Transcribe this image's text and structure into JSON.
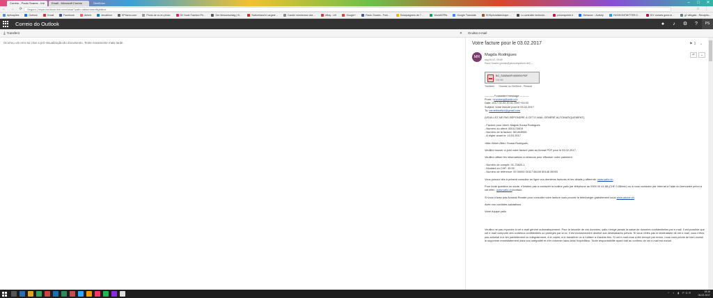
{
  "browser": {
    "tabs": [
      "Correio - Paulo Soares - Inb",
      "Email - Microsoft Correio",
      "OneDrive"
    ],
    "address": "Seguro | https://outlook.live.com/owa/?path=/attachmentlightbox",
    "bookmarks": [
      "Aplicações",
      "Outlook",
      "Gmail",
      "Facebook",
      "Airbnb",
      "decathlon",
      "EPrismo.com",
      "Photo de vu en photo",
      "3D Nude Fashion Ph…",
      "Der Messerschlag | B…",
      "Switzerland's Largest…",
      "Cardio' membrane obe…",
      "eBay - UK",
      "Google+",
      "Paulo Soares - Foto…",
      "Solarpaigners de 7 …",
      "WorldGPRs",
      "Google Translate",
      "SOSpécialistechape…",
      "Lu controller technolo…",
      "princesprinte.fr",
      "Behance :: Activity",
      "FASHIONTWITTER.C…",
      "DIY corsets gone-in…",
      "g2 allegate - Recapitu…",
      "Custom Motorcycles"
    ],
    "bookmarks_more": "Outros marcadores"
  },
  "app": {
    "name": "Correio do Outlook",
    "icons": [
      "skype-icon",
      "bell-icon",
      "gear-icon",
      "help-icon"
    ],
    "user_initials": "PS"
  },
  "toolbar": {
    "download_label": "Transferir",
    "close_glyph": "✕",
    "hide_email_label": "Ocultar e-mail"
  },
  "left": {
    "error_message": "Ocorreu um erro ao criar a pré-visualização do documento. Tente novamente mais tarde."
  },
  "email": {
    "subject": "Votre facture pour le 03.02.2017",
    "avatar_initials": "MR",
    "sender": "Magda Rodrigues",
    "date": "seg 06-02, 09:58",
    "to": "Paulo Soares (pimain@yanocimpadors.net) ⌄",
    "attachment": {
      "name": "BG_SUMMARY465909.PDF",
      "size": "104 KB"
    },
    "attachment_links": [
      "Transferir",
      "Guardar no OneDrive - Pessoal"
    ],
    "body": [
      "---------- Forwarded message ----------",
      "From: <invoicing@yallo.ch>",
      "Date: 2017-02-03 20:41 GMT+01:00",
      "Subject: Votre facture pour le 03.02.2017",
      "To: vemethsofia1@gmail.com",
      "",
      "(VEUILLEZ NE PAS RÉPONDRE À CET E-MAIL GÉNÉRÉ AUTOMATIQUEMENT).",
      "",
      "- Facture pour client: Magda Sousa Rodrigues",
      "- Numéro du client: 0001176619",
      "- Numéro de la facture: 501465909.",
      "- A régler avant le: 10.03.2017",
      "",
      "<title>Mme</title> Sousa Rodrigues,",
      "",
      "Veuillez trouver ci-joint votre facture yallo au format PDF pour le 03.02.2017.",
      "",
      "Veuillez utiliser les informations ci-dessous pour effectuer votre paiement:",
      "",
      "- Numéro de compte: 01-73820-1",
      "- Montant en CHF: 39.00",
      "- Numéro de référence: 00 00000 00117 66190 60148 39093",
      "",
      "Vous pouvez dès à présent consulter en ligne vos dernières factures et les détails y afférents: www.yallo.ch.",
      "",
      "Pour toute question ou doute, n'hésitez pas à contacter la hotline yallo par téléphone au 0900 00 44 88 (CHF 0.08/min) ou à nous contacter par Internet à l'aide du formulaire prévu à cet effet : www.yallo.ch/contact.",
      "",
      "Si vous n'avez pas Acrobat Reader pour consulter votre facture vous pouvez le télécharger gratuitement sous www.adobe.ch.",
      "",
      "Avec nos cordiales salutations",
      "",
      "Votre équipe yallo",
      "",
      "",
      "",
      "",
      "Veuillez ne pas répondre à cet e-mail généré automatiquement. Pour la sécurité de vos données, yallo n'exige jamais la saisie de données confidentielles par e-mail. Il est possible que cet e-mail comporte des contenus confidentiels ou protégés par la loi. Il est exclusivement destiné aux destinataires prévus. Si vous n'êtes pas le destinataire de cet e-mail, vous n'êtes pas autorisé à le lire partiellement ou intégralement, à le copier, à le transférer ou à l'utiliser à d'autres fins. Si cet e-mail vous a été envoyé par erreur, nous vous prions de bien vouloir le supprimer immédiatement dans son intégralité et d'en informer sans délai l'expéditeur. Toute responsabilité ayant trait au contenu de cet e-mail est exclue."
    ],
    "link_words": [
      "invoicing@yallo.ch",
      "vemethsofia1@gmail.com",
      "www.yallo.ch",
      "www.yallo.ch/contact",
      "www.adobe.ch"
    ]
  },
  "taskbar": {
    "time": "18:16",
    "date": "06-02-2017",
    "lang": "POR"
  },
  "colors": {
    "avatar": "#7a3c6e",
    "appbar": "#333333",
    "link": "#1a4fb3"
  }
}
